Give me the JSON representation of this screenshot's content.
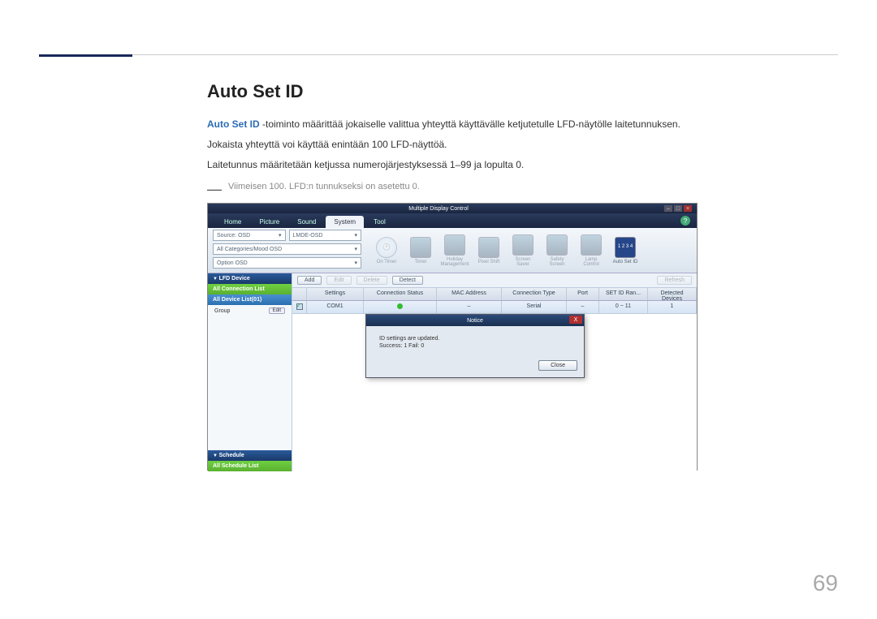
{
  "page": {
    "number": "69"
  },
  "doc": {
    "heading": "Auto Set ID",
    "p1_bold": "Auto Set ID",
    "p1_rest": " -toiminto määrittää jokaiselle valittua yhteyttä käyttävälle ketjutetulle LFD-näytölle laitetunnuksen.",
    "p2": "Jokaista yhteyttä voi käyttää enintään 100 LFD-näyttöä.",
    "p3": "Laitetunnus määritetään ketjussa numerojärjestyksessä 1–99 ja lopulta 0.",
    "note": "Viimeisen 100. LFD:n tunnukseksi on asetettu 0."
  },
  "app": {
    "title": "Multiple Display Control",
    "tabs": {
      "home": "Home",
      "picture": "Picture",
      "sound": "Sound",
      "system": "System",
      "tool": "Tool"
    },
    "combo1": "Source: OSD",
    "combo2": "LMDE-OSD",
    "ribbon": {
      "clock": "On Timer",
      "timer": "Timer",
      "holiday": "Holiday Management",
      "pixel": "Pixel Shift",
      "screen": "Screen Saver",
      "safety": "Safety Screen",
      "lamp": "Lamp Control",
      "autoset": "Auto Set ID",
      "autoset_grid": "1 2\n3 4"
    },
    "sidebar": {
      "lfd": "LFD Device",
      "conn": "All Connection List",
      "list": "All Device List(01)",
      "group": "Group",
      "edit": "Edit",
      "sched": "Schedule",
      "schedlist": "All Schedule List"
    },
    "toolbar": {
      "add": "Add",
      "edit": "Edit",
      "delete": "Delete",
      "detect": "Detect",
      "refresh": "Refresh"
    },
    "grid": {
      "h": {
        "settings": "Settings",
        "status": "Connection Status",
        "mac": "MAC Address",
        "type": "Connection Type",
        "port": "Port",
        "range": "SET ID Ran...",
        "detected": "Detected Devices"
      },
      "r": {
        "settings": "COM1",
        "status": "",
        "mac": "–",
        "type": "Serial",
        "port": "–",
        "range": "0 ~ 11",
        "detected": "1"
      }
    },
    "dialog": {
      "title": "Notice",
      "line1": "ID settings are updated.",
      "line2": "Success: 1  Fail: 0",
      "close": "Close"
    }
  }
}
